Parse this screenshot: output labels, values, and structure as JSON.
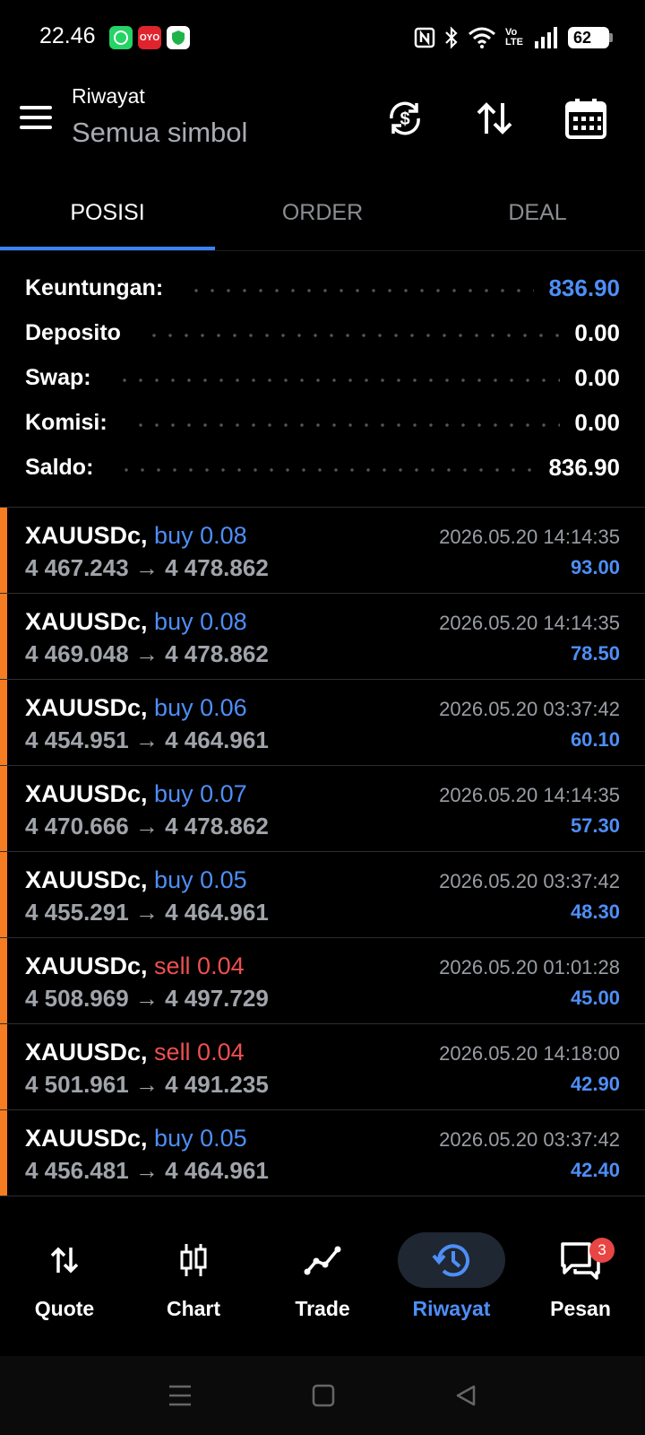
{
  "status_bar": {
    "time": "22.46",
    "apps": [
      "whatsapp-icon",
      "oyo-icon",
      "shield-icon"
    ],
    "oyo_text": "OYO",
    "volte_text": "Vo LTE",
    "battery": "62"
  },
  "header": {
    "subtitle": "Riwayat",
    "title": "Semua simbol"
  },
  "tabs": [
    {
      "label": "POSISI",
      "active": true
    },
    {
      "label": "ORDER",
      "active": false
    },
    {
      "label": "DEAL",
      "active": false
    }
  ],
  "summary": [
    {
      "label": "Keuntungan:",
      "value": "836.90",
      "highlight": true
    },
    {
      "label": "Deposito",
      "value": "0.00",
      "highlight": false
    },
    {
      "label": "Swap:",
      "value": "0.00",
      "highlight": false
    },
    {
      "label": "Komisi:",
      "value": "0.00",
      "highlight": false
    },
    {
      "label": "Saldo:",
      "value": "836.90",
      "highlight": false
    }
  ],
  "positions": [
    {
      "symbol": "XAUUSDc,",
      "side": "buy 0.08",
      "type": "buy",
      "prices": "4 467.243 → 4 478.862",
      "time": "2026.05.20 14:14:35",
      "profit": "93.00"
    },
    {
      "symbol": "XAUUSDc,",
      "side": "buy 0.08",
      "type": "buy",
      "prices": "4 469.048 → 4 478.862",
      "time": "2026.05.20 14:14:35",
      "profit": "78.50"
    },
    {
      "symbol": "XAUUSDc,",
      "side": "buy 0.06",
      "type": "buy",
      "prices": "4 454.951 → 4 464.961",
      "time": "2026.05.20 03:37:42",
      "profit": "60.10"
    },
    {
      "symbol": "XAUUSDc,",
      "side": "buy 0.07",
      "type": "buy",
      "prices": "4 470.666 → 4 478.862",
      "time": "2026.05.20 14:14:35",
      "profit": "57.30"
    },
    {
      "symbol": "XAUUSDc,",
      "side": "buy 0.05",
      "type": "buy",
      "prices": "4 455.291 → 4 464.961",
      "time": "2026.05.20 03:37:42",
      "profit": "48.30"
    },
    {
      "symbol": "XAUUSDc,",
      "side": "sell 0.04",
      "type": "sell",
      "prices": "4 508.969 → 4 497.729",
      "time": "2026.05.20 01:01:28",
      "profit": "45.00"
    },
    {
      "symbol": "XAUUSDc,",
      "side": "sell 0.04",
      "type": "sell",
      "prices": "4 501.961 → 4 491.235",
      "time": "2026.05.20 14:18:00",
      "profit": "42.90"
    },
    {
      "symbol": "XAUUSDc,",
      "side": "buy 0.05",
      "type": "buy",
      "prices": "4 456.481 → 4 464.961",
      "time": "2026.05.20 03:37:42",
      "profit": "42.40"
    }
  ],
  "bottom_nav": [
    {
      "label": "Quote",
      "icon": "quote-arrows-icon",
      "active": false
    },
    {
      "label": "Chart",
      "icon": "candlestick-icon",
      "active": false
    },
    {
      "label": "Trade",
      "icon": "trade-line-icon",
      "active": false
    },
    {
      "label": "Riwayat",
      "icon": "history-icon",
      "active": true
    },
    {
      "label": "Pesan",
      "icon": "message-icon",
      "active": false,
      "badge": "3"
    }
  ],
  "colors": {
    "accent": "#4e8ef7",
    "sell": "#ef4f4f",
    "position_bar": "#f57c20"
  }
}
